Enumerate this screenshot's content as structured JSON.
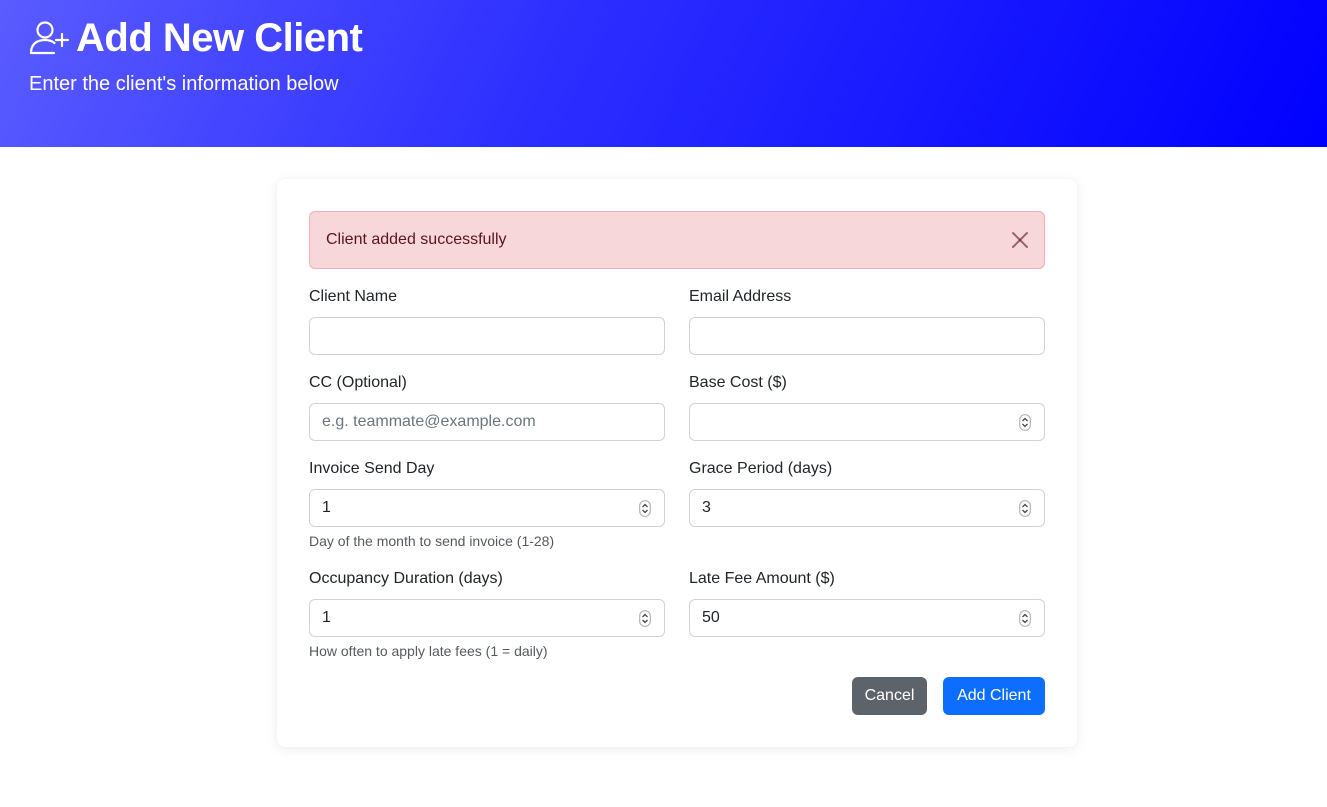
{
  "header": {
    "icon": "person-add-icon",
    "title": "Add New Client",
    "subtitle": "Enter the client's information below"
  },
  "alert": {
    "message": "Client added successfully",
    "close_icon": "close-icon",
    "background": "#f8d7da"
  },
  "form": {
    "client_name": {
      "label": "Client Name",
      "value": "",
      "placeholder": ""
    },
    "email": {
      "label": "Email Address",
      "value": "",
      "placeholder": ""
    },
    "cc": {
      "label": "CC (Optional)",
      "value": "",
      "placeholder": "e.g. teammate@example.com"
    },
    "base_cost": {
      "label": "Base Cost ($)",
      "value": "",
      "placeholder": ""
    },
    "invoice_send_day": {
      "label": "Invoice Send Day",
      "value": "1",
      "help": "Day of the month to send invoice (1-28)"
    },
    "grace_period": {
      "label": "Grace Period (days)",
      "value": "3"
    },
    "occupancy_duration": {
      "label": "Occupancy Duration (days)",
      "value": "1",
      "help": "How often to apply late fees (1 = daily)"
    },
    "late_fee": {
      "label": "Late Fee Amount ($)",
      "value": "50"
    }
  },
  "buttons": {
    "cancel": "Cancel",
    "add": "Add Client"
  },
  "colors": {
    "header_gradient_start": "#5a5cff",
    "header_gradient_end": "#0000ff",
    "primary": "#0d6efd",
    "secondary": "#5c636a"
  }
}
